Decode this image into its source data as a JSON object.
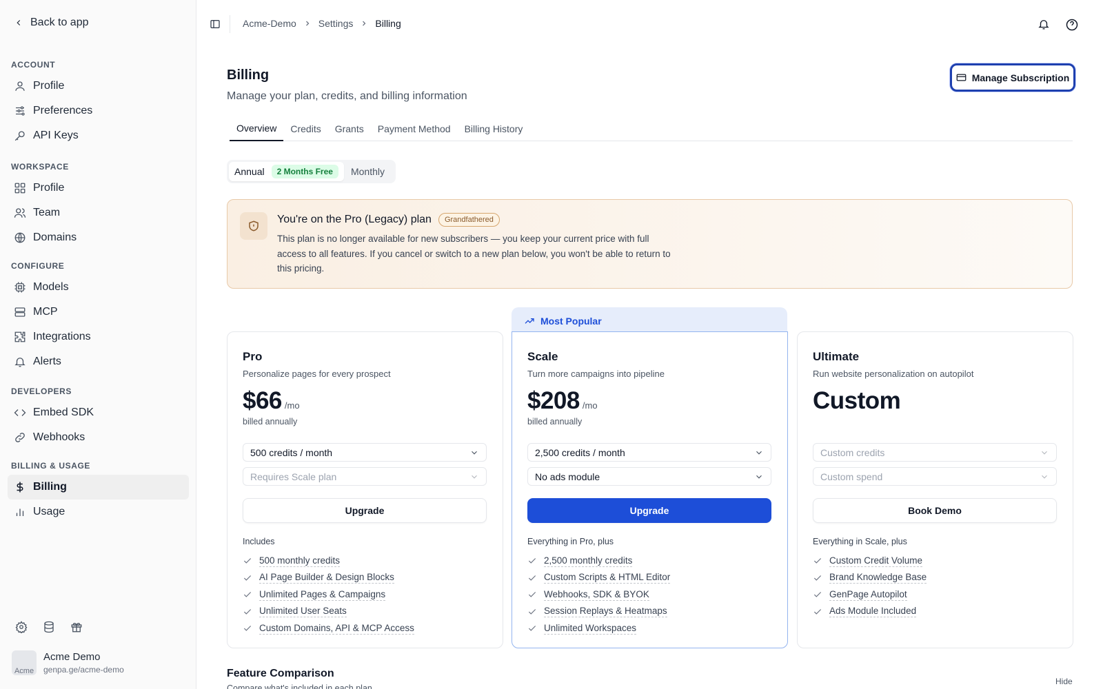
{
  "sidebar": {
    "back_label": "Back to app",
    "sections": {
      "account": "ACCOUNT",
      "workspace": "WORKSPACE",
      "configure": "CONFIGURE",
      "developers": "DEVELOPERS",
      "billing_usage": "BILLING & USAGE"
    },
    "items": {
      "profile": "Profile",
      "preferences": "Preferences",
      "api_keys": "API Keys",
      "ws_profile": "Profile",
      "team": "Team",
      "domains": "Domains",
      "models": "Models",
      "mcp": "MCP",
      "integrations": "Integrations",
      "alerts": "Alerts",
      "embed_sdk": "Embed SDK",
      "webhooks": "Webhooks",
      "billing": "Billing",
      "usage": "Usage"
    },
    "user": {
      "avatar_alt": "Acme",
      "name": "Acme Demo",
      "url": "genpa.ge/acme-demo"
    }
  },
  "breadcrumb": [
    "Acme-Demo",
    "Settings",
    "Billing"
  ],
  "header": {
    "title": "Billing",
    "subtitle": "Manage your plan, credits, and billing information",
    "manage_label": "Manage Subscription"
  },
  "tabs": [
    "Overview",
    "Credits",
    "Grants",
    "Payment Method",
    "Billing History"
  ],
  "billing_period": {
    "annual": "Annual",
    "badge": "2 Months Free",
    "monthly": "Monthly"
  },
  "notice": {
    "title": "You're on the Pro (Legacy) plan",
    "badge": "Grandfathered",
    "body": "This plan is no longer available for new subscribers — you keep your current price with full access to all features. If you cancel or switch to a new plan below, you won't be able to return to this pricing."
  },
  "popular_label": "Most Popular",
  "plans": [
    {
      "name": "Pro",
      "desc": "Personalize pages for every prospect",
      "price": "$66",
      "unit": "/mo",
      "billed": "billed annually",
      "select1": "500 credits / month",
      "select2": "Requires Scale plan",
      "button": "Upgrade",
      "features_head": "Includes",
      "features": [
        "500 monthly credits",
        "AI Page Builder & Design Blocks",
        "Unlimited Pages & Campaigns",
        "Unlimited User Seats",
        "Custom Domains, API & MCP Access"
      ]
    },
    {
      "name": "Scale",
      "desc": "Turn more campaigns into pipeline",
      "price": "$208",
      "unit": "/mo",
      "billed": "billed annually",
      "select1": "2,500 credits / month",
      "select2": "No ads module",
      "button": "Upgrade",
      "features_head": "Everything in Pro, plus",
      "features": [
        "2,500 monthly credits",
        "Custom Scripts & HTML Editor",
        "Webhooks, SDK & BYOK",
        "Session Replays & Heatmaps",
        "Unlimited Workspaces"
      ]
    },
    {
      "name": "Ultimate",
      "desc": "Run website personalization on autopilot",
      "price": "Custom",
      "select1": "Custom credits",
      "select2": "Custom spend",
      "button": "Book Demo",
      "features_head": "Everything in Scale, plus",
      "features": [
        "Custom Credit Volume",
        "Brand Knowledge Base",
        "GenPage Autopilot",
        "Ads Module Included"
      ]
    }
  ],
  "comparison": {
    "title": "Feature Comparison",
    "subtitle": "Compare what's included in each plan",
    "hide": "Hide"
  },
  "colors": {
    "accent": "#1d4ed8",
    "popular_bg": "#e6edfb",
    "badge_green": "#15803d",
    "notice_border": "#e8c9a8"
  }
}
